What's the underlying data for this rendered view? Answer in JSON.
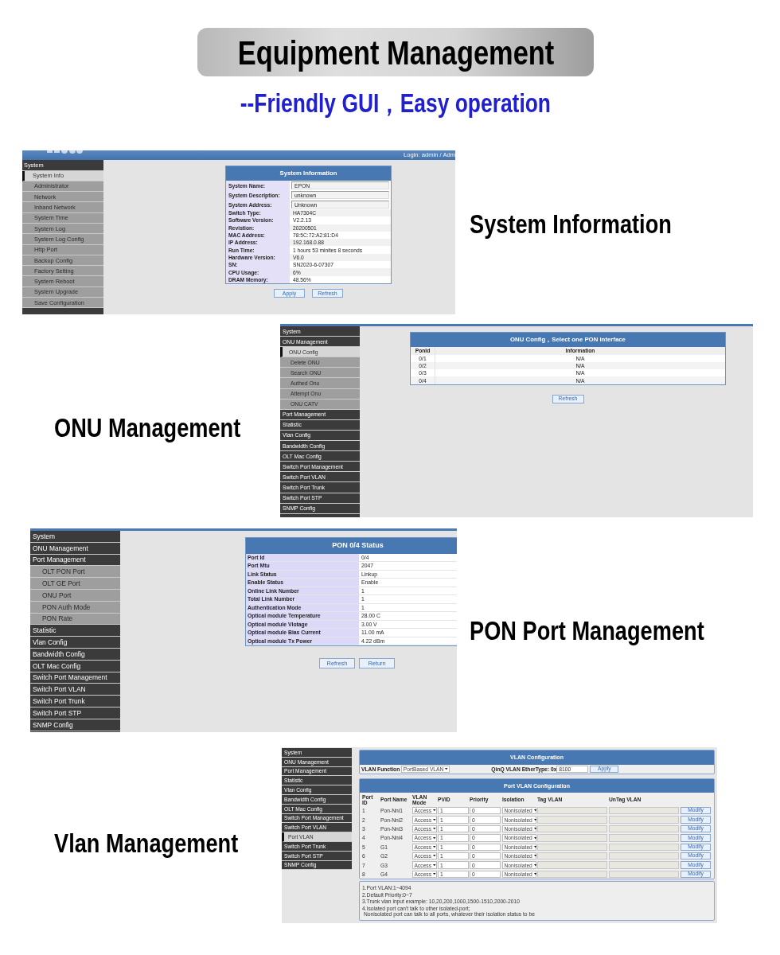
{
  "banner": {
    "title": "Equipment Management",
    "subtitle": "--Friendly GUI，Easy operation"
  },
  "sections": [
    {
      "caption": "System Information",
      "screen": {
        "kind": "system_info",
        "login": "Login: admin / Adm",
        "sidebar": [
          {
            "label": "System",
            "children": [
              {
                "label": "System Info",
                "selected": true
              },
              {
                "label": "Administrator",
                "selected": false
              },
              {
                "label": "Network",
                "selected": false
              },
              {
                "label": "Inband Network",
                "selected": false
              },
              {
                "label": "System Time",
                "selected": false
              },
              {
                "label": "System Log",
                "selected": false
              },
              {
                "label": "System Log Config",
                "selected": false
              },
              {
                "label": "Http Port",
                "selected": false
              },
              {
                "label": "Backup Config",
                "selected": false
              },
              {
                "label": "Factory Setting",
                "selected": false
              },
              {
                "label": "System Reboot",
                "selected": false
              },
              {
                "label": "System Upgrade",
                "selected": false
              },
              {
                "label": "Save Configuration",
                "selected": false
              }
            ]
          }
        ],
        "panel": {
          "title": "System Information",
          "rows": [
            {
              "label": "System Name:",
              "value": "EPON",
              "kind": "input"
            },
            {
              "label": "System Description:",
              "value": "unknown",
              "kind": "input"
            },
            {
              "label": "System Address:",
              "value": "Unknown",
              "kind": "input"
            },
            {
              "label": "Switch Type:",
              "value": "HA7304C",
              "kind": "text"
            },
            {
              "label": "Software Version:",
              "value": "V2.2.13",
              "kind": "text"
            },
            {
              "label": "Revistion:",
              "value": "20200501",
              "kind": "text"
            },
            {
              "label": "MAC Address:",
              "value": "78:5C:72:A2:81:D4",
              "kind": "text"
            },
            {
              "label": "IP Address:",
              "value": "192.168.0.88",
              "kind": "text"
            },
            {
              "label": "Run Time:",
              "value": "1 hours 53 minites 8 seconds",
              "kind": "text"
            },
            {
              "label": "Hardware Version:",
              "value": "V6.0",
              "kind": "text"
            },
            {
              "label": "SN:",
              "value": "SN2020-6-07307",
              "kind": "text"
            },
            {
              "label": "CPU Usage:",
              "value": "6%",
              "kind": "text"
            },
            {
              "label": "DRAM Memory:",
              "value": "48.56%",
              "kind": "text"
            }
          ]
        },
        "buttons": [
          "Apply",
          "Refresh"
        ]
      }
    },
    {
      "caption": "ONU Management",
      "screen": {
        "kind": "onu_config",
        "sidebar": [
          {
            "label": "System"
          },
          {
            "label": "ONU Management",
            "children": [
              {
                "label": "ONU Config",
                "selected": true
              },
              {
                "label": "Delete ONU",
                "selected": false
              },
              {
                "label": "Search ONU",
                "selected": false
              },
              {
                "label": "Authed Onu",
                "selected": false
              },
              {
                "label": "Attempt Onu",
                "selected": false
              },
              {
                "label": "ONU CATV",
                "selected": false
              }
            ]
          },
          {
            "label": "Port Management"
          },
          {
            "label": "Statistic"
          },
          {
            "label": "Vlan Config"
          },
          {
            "label": "Bandwidth Config"
          },
          {
            "label": "OLT Mac Config"
          },
          {
            "label": "Switch Port Management"
          },
          {
            "label": "Switch Port VLAN"
          },
          {
            "label": "Switch Port Trunk"
          },
          {
            "label": "Switch Port STP"
          },
          {
            "label": "SNMP Config"
          }
        ],
        "panel": {
          "title": "ONU Config，Select one PON interface",
          "columns": [
            "PonId",
            "Information"
          ],
          "rows": [
            [
              "0/1",
              "N/A"
            ],
            [
              "0/2",
              "N/A"
            ],
            [
              "0/3",
              "N/A"
            ],
            [
              "0/4",
              "N/A"
            ]
          ]
        },
        "buttons": [
          "Refresh"
        ]
      }
    },
    {
      "caption": "PON Port Management",
      "screen": {
        "kind": "pon_status",
        "sidebar": [
          {
            "label": "System"
          },
          {
            "label": "ONU Management"
          },
          {
            "label": "Port Management",
            "children": [
              {
                "label": "OLT PON Port",
                "selected": false
              },
              {
                "label": "OLT GE Port",
                "selected": false
              },
              {
                "label": "ONU Port",
                "selected": false
              },
              {
                "label": "PON Auth Mode",
                "selected": false
              },
              {
                "label": "PON Rate",
                "selected": false
              }
            ]
          },
          {
            "label": "Statistic"
          },
          {
            "label": "Vlan Config"
          },
          {
            "label": "Bandwidth Config"
          },
          {
            "label": "OLT Mac Config"
          },
          {
            "label": "Switch Port Management"
          },
          {
            "label": "Switch Port VLAN"
          },
          {
            "label": "Switch Port Trunk"
          },
          {
            "label": "Switch Port STP"
          },
          {
            "label": "SNMP Config"
          }
        ],
        "panel": {
          "title": "PON 0/4 Status",
          "rows": [
            {
              "label": "Port Id",
              "value": "0/4"
            },
            {
              "label": "Port Mtu",
              "value": "2047"
            },
            {
              "label": "Link Status",
              "value": "Linkup"
            },
            {
              "label": "Enable Status",
              "value": "Enable"
            },
            {
              "label": "Online Link Number",
              "value": "1"
            },
            {
              "label": "Total Link Number",
              "value": "1"
            },
            {
              "label": "Authentication Mode",
              "value": "1"
            },
            {
              "label": "Optical module Temperature",
              "value": "28.00 C"
            },
            {
              "label": "Optical module Vlotage",
              "value": "3.00 V"
            },
            {
              "label": "Optical module Bias Current",
              "value": "11.00 mA"
            },
            {
              "label": "Optical module Tx Power",
              "value": "4.22 dBm"
            }
          ]
        },
        "buttons": [
          "Refresh",
          "Return"
        ]
      }
    },
    {
      "caption": "Vlan Management",
      "screen": {
        "kind": "vlan",
        "sidebar": [
          {
            "label": "System"
          },
          {
            "label": "ONU Management"
          },
          {
            "label": "Port Management"
          },
          {
            "label": "Statistic"
          },
          {
            "label": "Vlan Config"
          },
          {
            "label": "Bandwidth Config"
          },
          {
            "label": "OLT Mac Config"
          },
          {
            "label": "Switch Port Management"
          },
          {
            "label": "Switch Port VLAN",
            "children": [
              {
                "label": "Port VLAN",
                "selected": true
              }
            ]
          },
          {
            "label": "Switch Port Trunk"
          },
          {
            "label": "Switch Port STP"
          },
          {
            "label": "SNMP Config"
          }
        ],
        "vlan_panel": {
          "title": "VLAN Configuration",
          "function_label": "VLAN Function",
          "function_value": "PortBased VLAN",
          "ethertype_label": "QinQ VLAN EtherType: 0x",
          "ethertype_value": "8100",
          "button": "Apply"
        },
        "port_panel": {
          "title": "Port VLAN Configuration",
          "columns": [
            "Port ID",
            "Port Name",
            "VLAN Mode",
            "PVID",
            "Priority",
            "Isolation",
            "Tag VLAN",
            "UnTag VLAN"
          ],
          "tag_fields_disabled": true,
          "rows": [
            {
              "port_id": "1",
              "port_name": "Pon-Nni1",
              "mode": "Access",
              "pvid": "1",
              "priority": "0",
              "isolation": "Nonisolated",
              "button": "Modify"
            },
            {
              "port_id": "2",
              "port_name": "Pon-Nni2",
              "mode": "Access",
              "pvid": "1",
              "priority": "0",
              "isolation": "Nonisolated",
              "button": "Modify"
            },
            {
              "port_id": "3",
              "port_name": "Pon-Nni3",
              "mode": "Access",
              "pvid": "1",
              "priority": "0",
              "isolation": "Nonisolated",
              "button": "Modify"
            },
            {
              "port_id": "4",
              "port_name": "Pon-Nni4",
              "mode": "Access",
              "pvid": "1",
              "priority": "0",
              "isolation": "Nonisolated",
              "button": "Modify"
            },
            {
              "port_id": "5",
              "port_name": "G1",
              "mode": "Access",
              "pvid": "1",
              "priority": "0",
              "isolation": "Nonisolated",
              "button": "Modify"
            },
            {
              "port_id": "6",
              "port_name": "G2",
              "mode": "Access",
              "pvid": "1",
              "priority": "0",
              "isolation": "Nonisolated",
              "button": "Modify"
            },
            {
              "port_id": "7",
              "port_name": "G3",
              "mode": "Access",
              "pvid": "1",
              "priority": "0",
              "isolation": "Nonisolated",
              "button": "Modify"
            },
            {
              "port_id": "8",
              "port_name": "G4",
              "mode": "Access",
              "pvid": "1",
              "priority": "0",
              "isolation": "Nonisolated",
              "button": "Modify"
            }
          ]
        },
        "notes": [
          "1.Port VLAN:1~4094",
          "2.Default Priority:0~7",
          "3.Trunk vlan input example: 10,20,200,1000,1500-1510,2000-2010",
          "4.Isolated port can't talk to other isolated-port;\nNonisolated port can talk to all ports, whatever their isolation status to be"
        ]
      }
    }
  ]
}
